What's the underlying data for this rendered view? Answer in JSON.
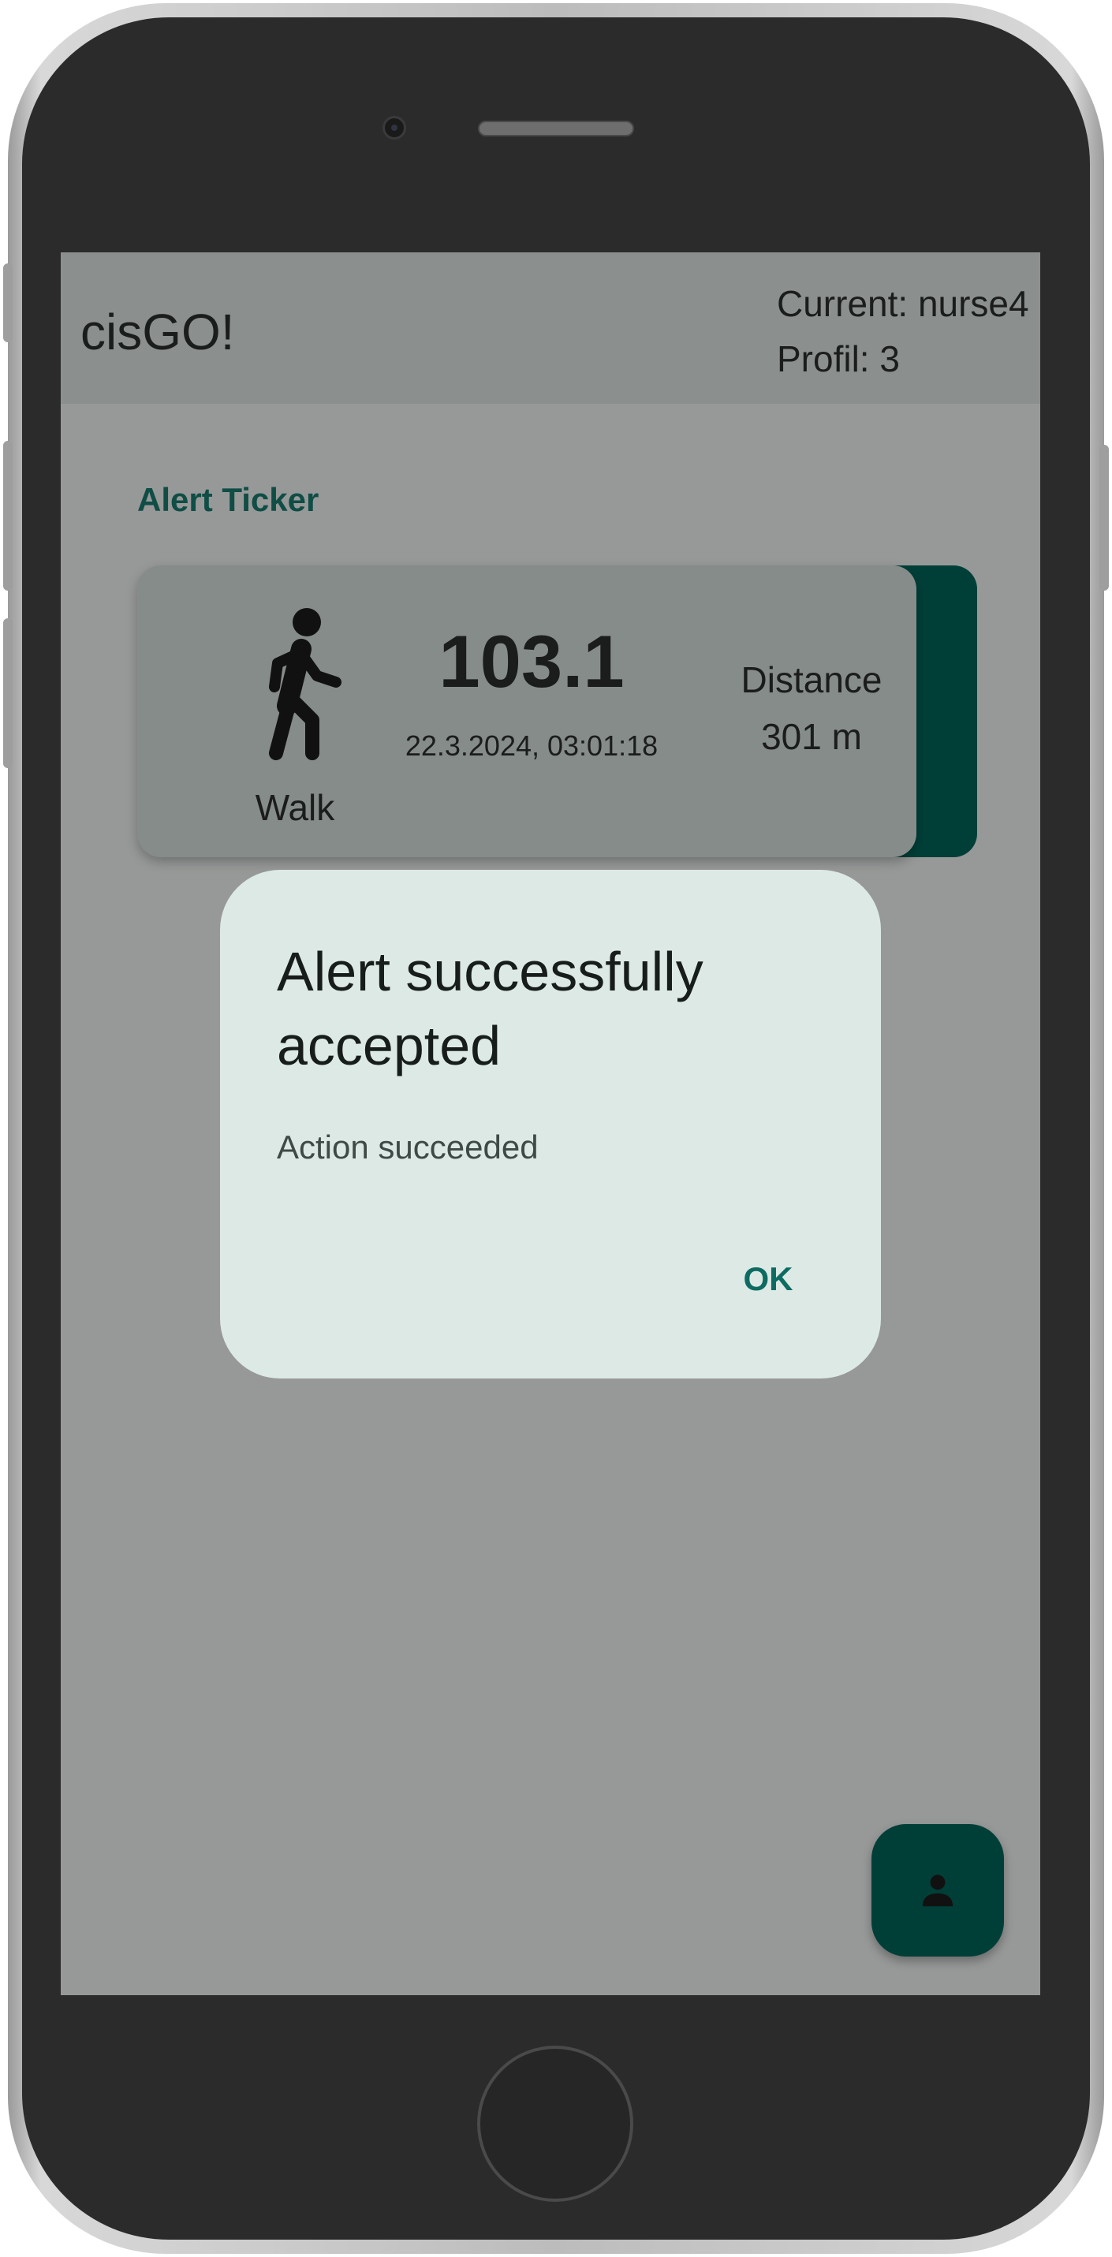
{
  "app": {
    "title": "cisGO!"
  },
  "user": {
    "current": "Current: nurse4",
    "profile": "Profil: 3"
  },
  "section": {
    "label": "Alert Ticker"
  },
  "alert_card": {
    "activity_icon": "walk-icon",
    "activity_label": "Walk",
    "value": "103.1",
    "timestamp": "22.3.2024, 03:01:18",
    "metric_name": "Distance",
    "metric_value": "301 m"
  },
  "dialog": {
    "title": "Alert successfully accepted",
    "message": "Action succeeded",
    "ok_label": "OK"
  },
  "fab": {
    "icon": "person-icon"
  },
  "colors": {
    "accent": "#003f38",
    "dialog_bg": "#dde9e5",
    "ok_text": "#0d6b61",
    "section_label": "#0f4d45"
  }
}
